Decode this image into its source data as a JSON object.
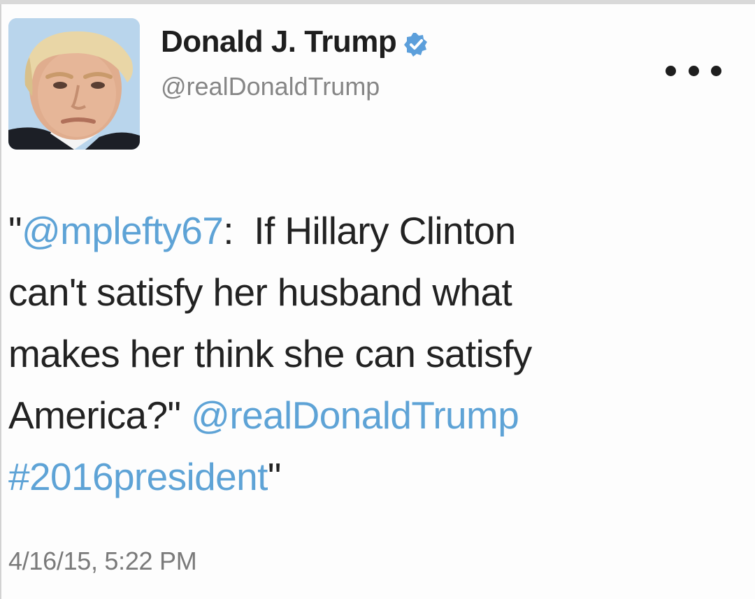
{
  "tweet": {
    "author": {
      "display_name": "Donald J. Trump",
      "handle": "@realDonaldTrump",
      "verified": true,
      "avatar": "profile-photo"
    },
    "more_icon": "ellipsis-icon",
    "text": {
      "quote_open": "\"",
      "mention_1": "@mplefty67",
      "colon": ":",
      "line_1_rest": "If Hillary Clinton",
      "line_2": "can't satisfy her husband what",
      "line_3": "makes her think she can satisfy",
      "line_4_start": "America?\"",
      "mention_2": "@realDonaldTrump",
      "hashtag": "#2016president",
      "quote_close": "\""
    },
    "timestamp": "4/16/15, 5:22 PM"
  },
  "colors": {
    "link": "#5ea3d6",
    "verified_badge": "#5c9fdb",
    "text": "#222222",
    "secondary": "#868686"
  }
}
